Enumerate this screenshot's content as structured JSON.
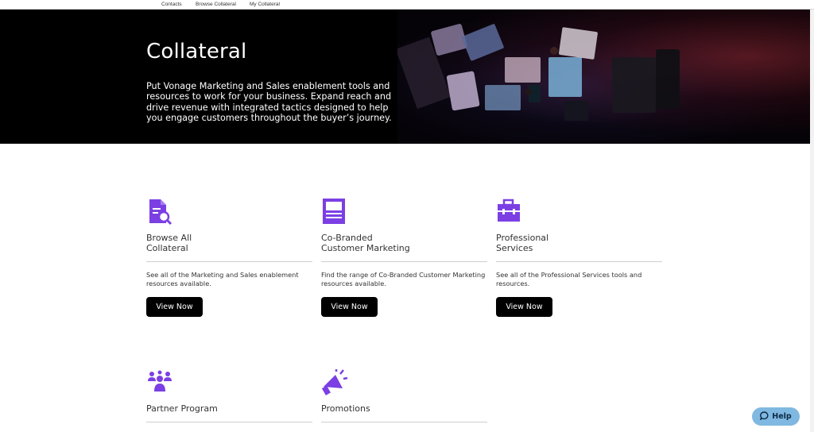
{
  "topnav": {
    "items": [
      {
        "label": "Contacts"
      },
      {
        "label": "Browse Collateral"
      },
      {
        "label": "My Collateral"
      }
    ]
  },
  "hero": {
    "title": "Collateral",
    "description": "Put Vonage Marketing and Sales enablement tools and resources to work for your business. Expand reach and drive revenue with integrated tactics designed to help you engage customers throughout the buyer’s journey."
  },
  "cards": [
    {
      "icon": "document-search-icon",
      "title": "Browse All\nCollateral",
      "description": "See all of the Marketing and Sales enablement resources available.",
      "button": "View Now"
    },
    {
      "icon": "newsletter-icon",
      "title": "Co-Branded\nCustomer Marketing",
      "description": "Find the range of Co-Branded Customer Marketing resources available.",
      "button": "View Now"
    },
    {
      "icon": "briefcase-icon",
      "title": "Professional\nServices",
      "description": "See all of the Professional Services tools and resources.",
      "button": "View Now"
    },
    {
      "icon": "people-group-icon",
      "title": "Partner Program"
    },
    {
      "icon": "megaphone-icon",
      "title": "Promotions"
    }
  ],
  "help": {
    "label": "Help",
    "icon": "chat-bubble-icon"
  },
  "colors": {
    "accent": "#7b3fe4",
    "button": "#000000",
    "help": "#7fb8e0"
  }
}
